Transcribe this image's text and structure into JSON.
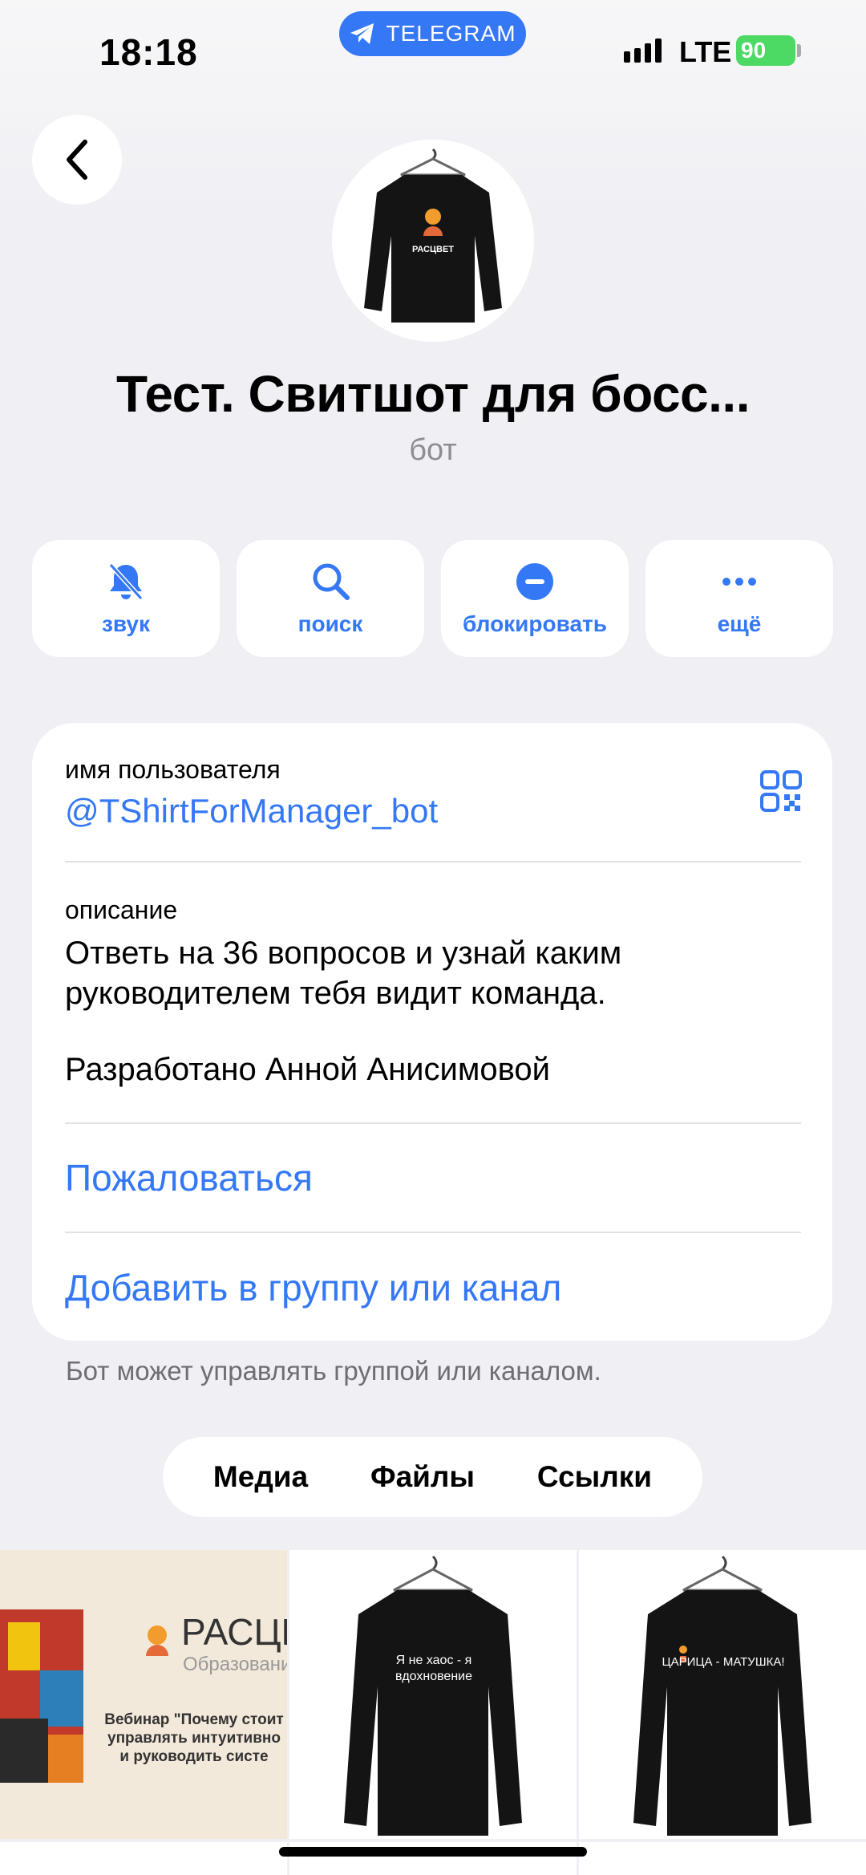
{
  "status_bar": {
    "time": "18:18",
    "app_pill": "TELEGRAM",
    "network": "LTE",
    "battery": "90"
  },
  "profile": {
    "title": "Тест. Свитшот для босс...",
    "subtitle": "бот",
    "avatar_caption": "РАСЦВЕТ"
  },
  "actions": [
    {
      "label": "звук",
      "icon": "bell-slash-icon"
    },
    {
      "label": "поиск",
      "icon": "search-icon"
    },
    {
      "label": "блокировать",
      "icon": "block-icon"
    },
    {
      "label": "ещё",
      "icon": "more-icon"
    }
  ],
  "info": {
    "username_label": "имя пользователя",
    "username": "@TShirtForManager_bot",
    "description_label": "описание",
    "description": "Ответь на 36 вопросов и узнай каким руководителем тебя видит команда.",
    "developer": "Разработано Анной Анисимовой",
    "report": "Пожаловаться",
    "add_to_group": "Добавить в группу или канал"
  },
  "note": "Бот может управлять группой или каналом.",
  "tabs": [
    "Медиа",
    "Файлы",
    "Ссылки"
  ],
  "media": {
    "tile1_brand": "РАСЦВЕТ",
    "tile1_sub": "Образовани",
    "tile1_text": "Вебинар \"Почему стоит управлять интуитивно и руководить систе",
    "tile2_text": "Я не хаос - я вдохновение",
    "tile3_text": "ЦАРИЦА - МАТУШКА!"
  },
  "colors": {
    "accent": "#3478f6",
    "background": "#efeff4",
    "battery": "#4cd964"
  }
}
